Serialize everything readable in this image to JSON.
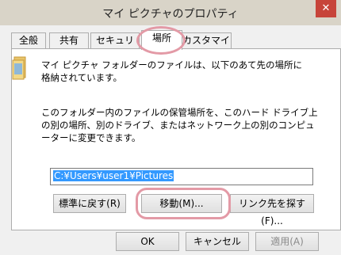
{
  "window": {
    "title": "マイ ピクチャのプロパティ",
    "close_symbol": "✕"
  },
  "tabs": [
    {
      "label": "全般"
    },
    {
      "label": "共有"
    },
    {
      "label": "セキュリティ"
    },
    {
      "label": "場所"
    },
    {
      "label": "カスタマイズ"
    }
  ],
  "location": {
    "description1": "マイ ピクチャ フォルダーのファイルは、以下のあて先の場所に格納されています。",
    "description2": "このフォルダー内のファイルの保管場所を、このハード ドライブ上の別の場所、別のドライブ、またはネットワーク上の別のコンピューターに変更できます。",
    "path_value": "C:¥Users¥user1¥Pictures",
    "buttons": {
      "restore_default": "標準に戻す(R)",
      "move": "移動(M)...",
      "find_target": "リンク先を探す(F)..."
    }
  },
  "footer": {
    "ok": "OK",
    "cancel": "キャンセル",
    "apply": "適用(A)"
  },
  "colors": {
    "highlight": "#e39aa6",
    "selection": "#3399ff",
    "close_red": "#c7443a"
  }
}
